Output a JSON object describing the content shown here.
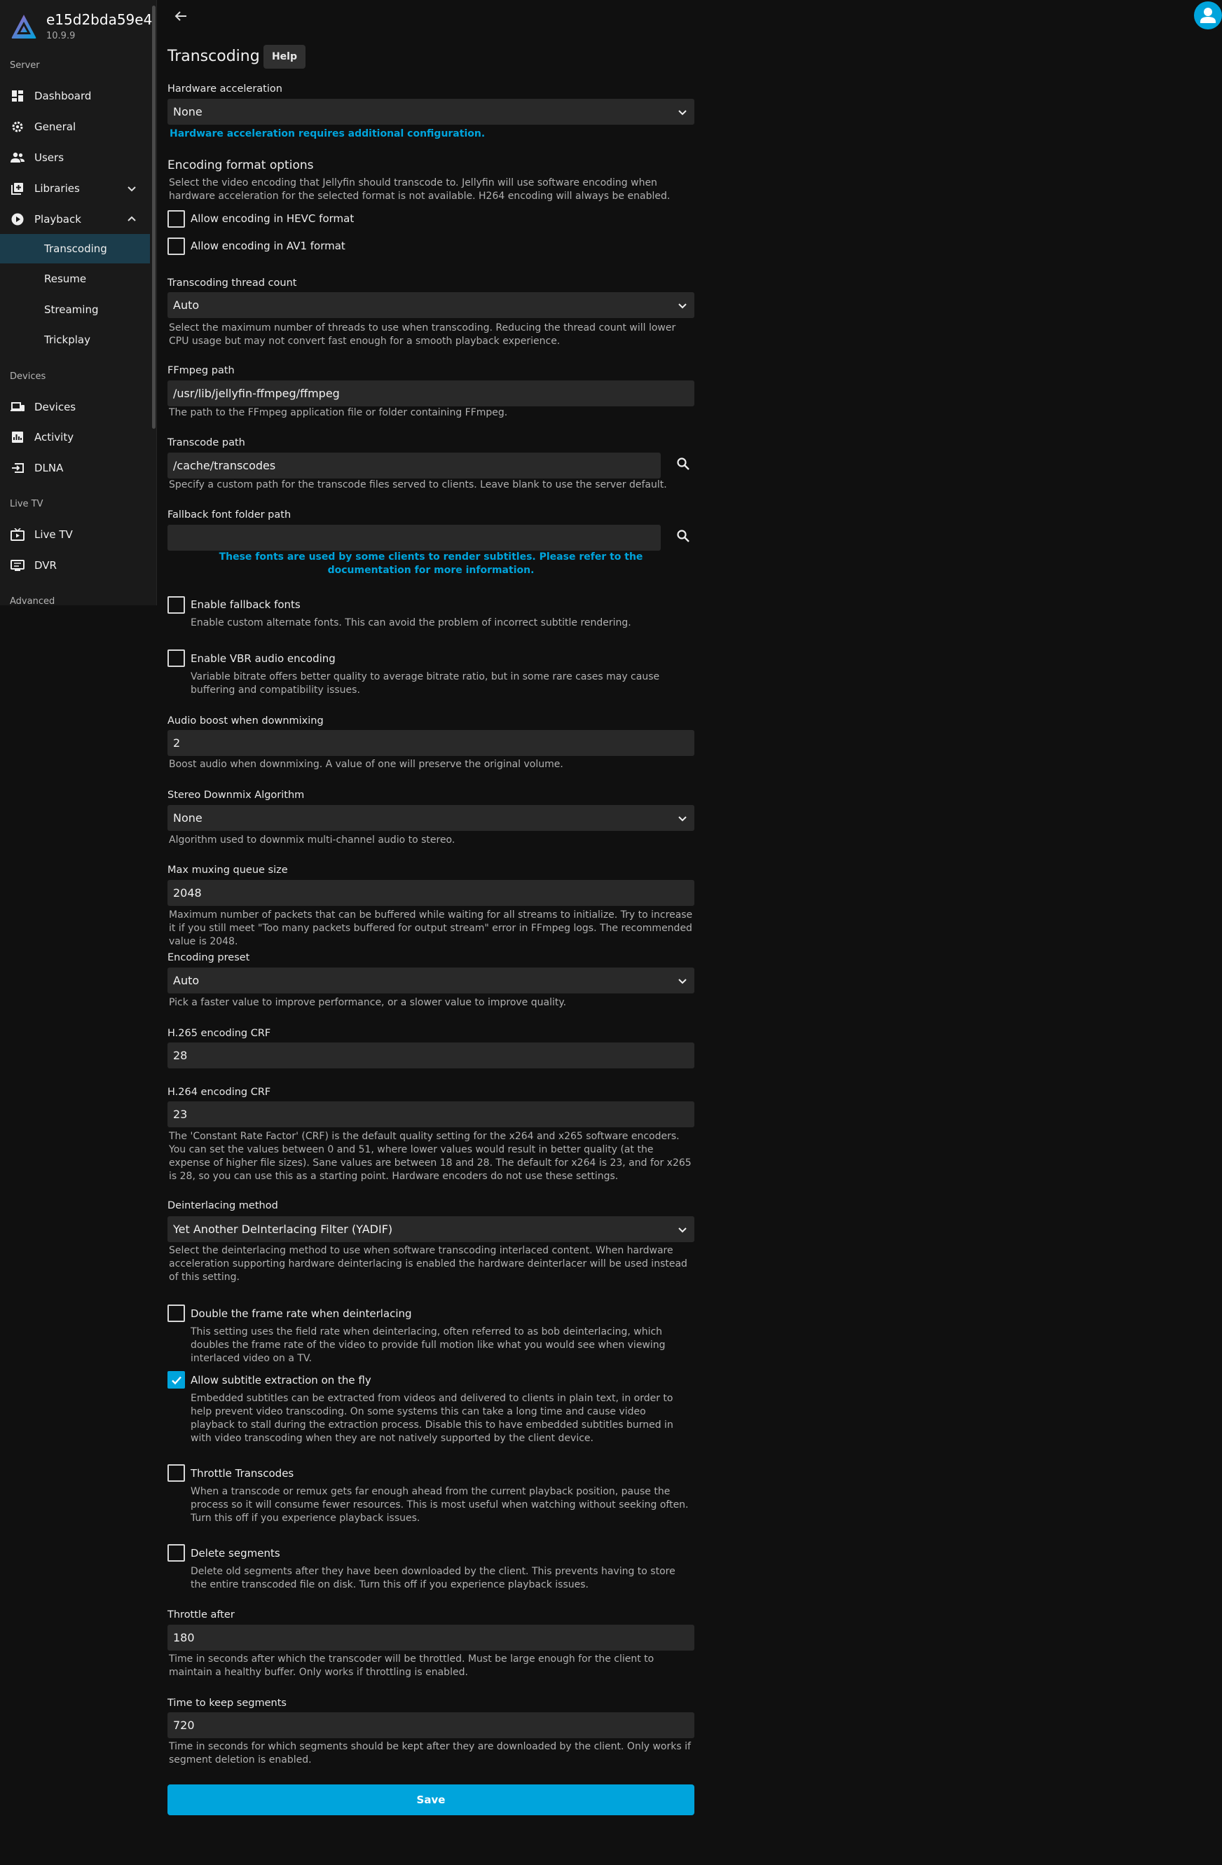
{
  "server": {
    "name": "e15d2bda59e4",
    "version": "10.9.9"
  },
  "sidebar": {
    "sections": {
      "server": "Server",
      "devices": "Devices",
      "livetv": "Live TV",
      "advanced": "Advanced"
    },
    "items": {
      "dashboard": "Dashboard",
      "general": "General",
      "users": "Users",
      "libraries": "Libraries",
      "playback": "Playback",
      "transcoding": "Transcoding",
      "resume": "Resume",
      "streaming": "Streaming",
      "trickplay": "Trickplay",
      "devices": "Devices",
      "activity": "Activity",
      "dlna": "DLNA",
      "livetv": "Live TV",
      "dvr": "DVR"
    }
  },
  "page": {
    "title": "Transcoding",
    "help": "Help",
    "hw_accel": {
      "label": "Hardware acceleration",
      "value": "None",
      "note": "Hardware acceleration requires additional configuration."
    },
    "encoding_format": {
      "heading": "Encoding format options",
      "desc": "Select the video encoding that Jellyfin should transcode to. Jellyfin will use software encoding when hardware acceleration for the selected format is not available. H264 encoding will always be enabled.",
      "hevc": "Allow encoding in HEVC format",
      "av1": "Allow encoding in AV1 format"
    },
    "thread_count": {
      "label": "Transcoding thread count",
      "value": "Auto",
      "desc": "Select the maximum number of threads to use when transcoding. Reducing the thread count will lower CPU usage but may not convert fast enough for a smooth playback experience."
    },
    "ffmpeg": {
      "label": "FFmpeg path",
      "value": "/usr/lib/jellyfin-ffmpeg/ffmpeg",
      "desc": "The path to the FFmpeg application file or folder containing FFmpeg."
    },
    "transcode_path": {
      "label": "Transcode path",
      "value": "/cache/transcodes",
      "desc": "Specify a custom path for the transcode files served to clients. Leave blank to use the server default."
    },
    "fallback_font": {
      "label": "Fallback font folder path",
      "value": "",
      "note": "These fonts are used by some clients to render subtitles. Please refer to the documentation for more information."
    },
    "enable_fallback": {
      "label": "Enable fallback fonts",
      "desc": "Enable custom alternate fonts. This can avoid the problem of incorrect subtitle rendering."
    },
    "vbr": {
      "label": "Enable VBR audio encoding",
      "desc": "Variable bitrate offers better quality to average bitrate ratio, but in some rare cases may cause buffering and compatibility issues."
    },
    "audio_boost": {
      "label": "Audio boost when downmixing",
      "value": "2",
      "desc": "Boost audio when downmixing. A value of one will preserve the original volume."
    },
    "downmix": {
      "label": "Stereo Downmix Algorithm",
      "value": "None",
      "desc": "Algorithm used to downmix multi-channel audio to stereo."
    },
    "muxing": {
      "label": "Max muxing queue size",
      "value": "2048",
      "desc": "Maximum number of packets that can be buffered while waiting for all streams to initialize. Try to increase it if you still meet \"Too many packets buffered for output stream\" error in FFmpeg logs. The recommended value is 2048."
    },
    "preset": {
      "label": "Encoding preset",
      "value": "Auto",
      "desc": "Pick a faster value to improve performance, or a slower value to improve quality."
    },
    "h265": {
      "label": "H.265 encoding CRF",
      "value": "28"
    },
    "h264": {
      "label": "H.264 encoding CRF",
      "value": "23",
      "desc": "The 'Constant Rate Factor' (CRF) is the default quality setting for the x264 and x265 software encoders. You can set the values between 0 and 51, where lower values would result in better quality (at the expense of higher file sizes). Sane values are between 18 and 28. The default for x264 is 23, and for x265 is 28, so you can use this as a starting point. Hardware encoders do not use these settings."
    },
    "deinterlace": {
      "label": "Deinterlacing method",
      "value": "Yet Another DeInterlacing Filter (YADIF)",
      "desc": "Select the deinterlacing method to use when software transcoding interlaced content. When hardware acceleration supporting hardware deinterlacing is enabled the hardware deinterlacer will be used instead of this setting."
    },
    "double_rate": {
      "label": "Double the frame rate when deinterlacing",
      "desc": "This setting uses the field rate when deinterlacing, often referred to as bob deinterlacing, which doubles the frame rate of the video to provide full motion like what you would see when viewing interlaced video on a TV."
    },
    "subtitle": {
      "label": "Allow subtitle extraction on the fly",
      "desc": "Embedded subtitles can be extracted from videos and delivered to clients in plain text, in order to help prevent video transcoding. On some systems this can take a long time and cause video playback to stall during the extraction process. Disable this to have embedded subtitles burned in with video transcoding when they are not natively supported by the client device."
    },
    "throttle": {
      "label": "Throttle Transcodes",
      "desc": "When a transcode or remux gets far enough ahead from the current playback position, pause the process so it will consume fewer resources. This is most useful when watching without seeking often. Turn this off if you experience playback issues."
    },
    "delete_segments": {
      "label": "Delete segments",
      "desc": "Delete old segments after they have been downloaded by the client. This prevents having to store the entire transcoded file on disk. Turn this off if you experience playback issues."
    },
    "throttle_after": {
      "label": "Throttle after",
      "value": "180",
      "desc": "Time in seconds after which the transcoder will be throttled. Must be large enough for the client to maintain a healthy buffer. Only works if throttling is enabled."
    },
    "keep_segments": {
      "label": "Time to keep segments",
      "value": "720",
      "desc": "Time in seconds for which segments should be kept after they are downloaded by the client. Only works if segment deletion is enabled."
    },
    "save": "Save"
  },
  "colors": {
    "accent": "#00a4dc",
    "background": "#101010",
    "sidebar": "#1a1a1a",
    "field": "#292929"
  }
}
